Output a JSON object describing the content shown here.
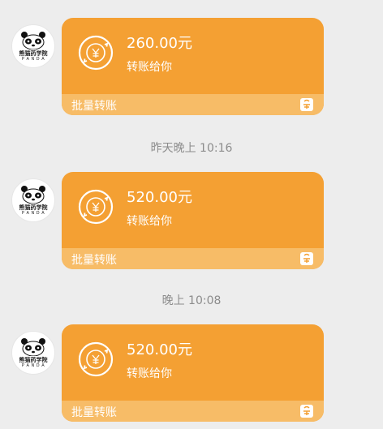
{
  "messages": [
    {
      "amount": "260.00元",
      "desc": "转账给你",
      "footer": "批量转账"
    },
    {
      "amount": "520.00元",
      "desc": "转账给你",
      "footer": "批量转账"
    },
    {
      "amount": "520.00元",
      "desc": "转账给你",
      "footer": "批量转账"
    }
  ],
  "timestamps": [
    "昨天晚上 10:16",
    "晚上 10:08"
  ],
  "avatar": {
    "line1": "熊猫药学院",
    "line2": "P A N D A"
  },
  "colors": {
    "card": "#f4a033",
    "card_footer": "#f7bc67",
    "background": "#ededed"
  },
  "icons": [
    "transfer-coin-icon",
    "red-packet-icon",
    "panda-avatar-icon"
  ]
}
